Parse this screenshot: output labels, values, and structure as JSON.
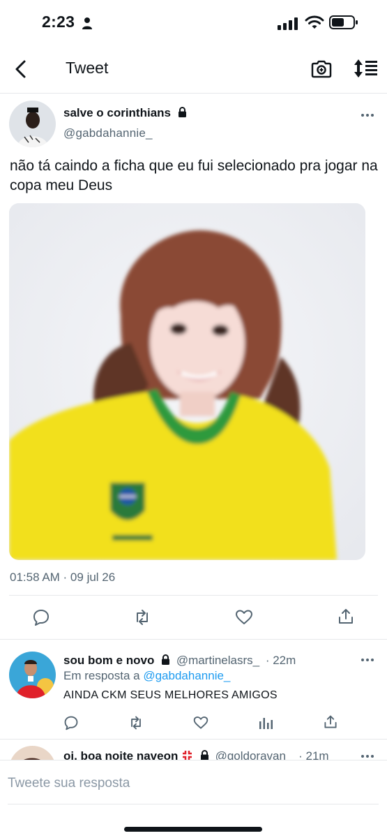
{
  "status_bar": {
    "time": "2:23"
  },
  "header": {
    "title": "Tweet"
  },
  "tweet": {
    "author_name": "salve o corinthians",
    "author_handle": "@gabdahannie_",
    "text": "não tá caindo a ficha que eu fui selecionado pra jogar na copa meu Deus",
    "timestamp": "01:58 AM · 09 jul 26"
  },
  "reply": {
    "author_name": "sou bom e novo",
    "author_handle": "@martinelasrs_",
    "time": "· 22m",
    "reply_prefix": "Em resposta a",
    "reply_to": "@gabdahannie_",
    "text": "AINDA CKM SEUS MELHORES AMIGOS"
  },
  "next_reply": {
    "author_name": "oi, boa noite naveon",
    "author_handle": "@goldoravan_",
    "time": "· 21m"
  },
  "compose": {
    "placeholder": "Tweete sua resposta"
  },
  "colors": {
    "accent": "#1d9bf0",
    "secondary_text": "#536471",
    "shirt_yellow": "#f2e01e",
    "collar_green": "#2e9a3c"
  }
}
